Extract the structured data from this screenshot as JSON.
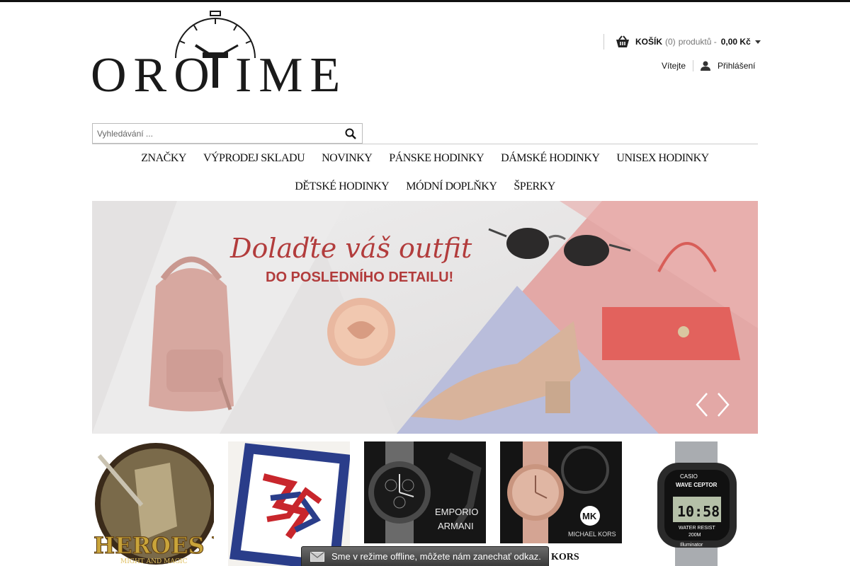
{
  "brand": {
    "logo_left": "ORO",
    "logo_right": "IME"
  },
  "header": {
    "cart_label": "KOŠÍK",
    "cart_count": "(0)",
    "cart_suffix": "produktů -",
    "cart_price": "0,00 Kč",
    "welcome": "Vítejte",
    "login": "Přihlášení"
  },
  "search": {
    "placeholder": "Vyhledávání ..."
  },
  "nav": {
    "row1": [
      "ZNAČKY",
      "VÝPRODEJ SKLADU",
      "NOVINKY",
      "PÁNSKE HODINKY",
      "DÁMSKÉ HODINKY",
      "UNISEX HODINKY"
    ],
    "row2": [
      "DĚTSKÉ HODINKY",
      "MÓDNÍ DOPLŇKY",
      "ŠPERKY"
    ]
  },
  "banner": {
    "headline": "Dolaďte váš outfit",
    "subline": "DO POSLEDNÍHO DETAILU!"
  },
  "thumbs": {
    "t1_text": "HEROES V",
    "t1_sub": "MIGHT AND MAGIC",
    "t3_text_1": "EMPORIO",
    "t3_text_2": "ARMANI",
    "t4_logo": "MK",
    "t4_text": "MICHAEL KORS",
    "t5_brand": "CASIO",
    "t5_model": "WAVE CEPTOR",
    "t5_time": "10:58",
    "t5_wr": "WATER RESIST",
    "t5_depth": "200M",
    "t5_illum": "Illuminator",
    "caption": "KORS"
  },
  "chat": {
    "text": "Sme v režime offline, môžete nám zanechať odkaz."
  },
  "colors": {
    "accent": "#111111",
    "banner_pink": "#e8a9a9",
    "banner_blue": "#b8bddc"
  }
}
